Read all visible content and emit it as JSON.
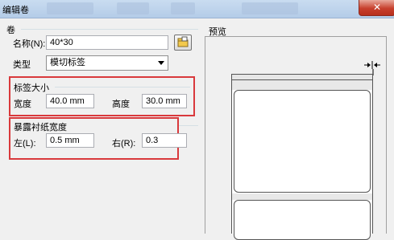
{
  "window": {
    "title": "编辑卷",
    "close_symbol": "✕"
  },
  "roll": {
    "section_label": "卷",
    "name_label": "名称(N):",
    "name_value": "40*30",
    "type_label": "类型",
    "type_value": "模切标签"
  },
  "label_size": {
    "section_label": "标签大小",
    "width_label": "宽度",
    "width_value": "40.0 mm",
    "height_label": "高度",
    "height_value": "30.0 mm"
  },
  "liner_width": {
    "section_label": "暴露衬纸宽度",
    "left_label": "左(L):",
    "left_value": "0.5 mm",
    "right_label": "右(R):",
    "right_value": "0.3"
  },
  "preview": {
    "section_label": "预览",
    "marker_icon": "width-arrows-icon"
  },
  "colors": {
    "highlight": "#d9393c",
    "titlebar": "#c9dcf0",
    "close": "#c7402d"
  }
}
